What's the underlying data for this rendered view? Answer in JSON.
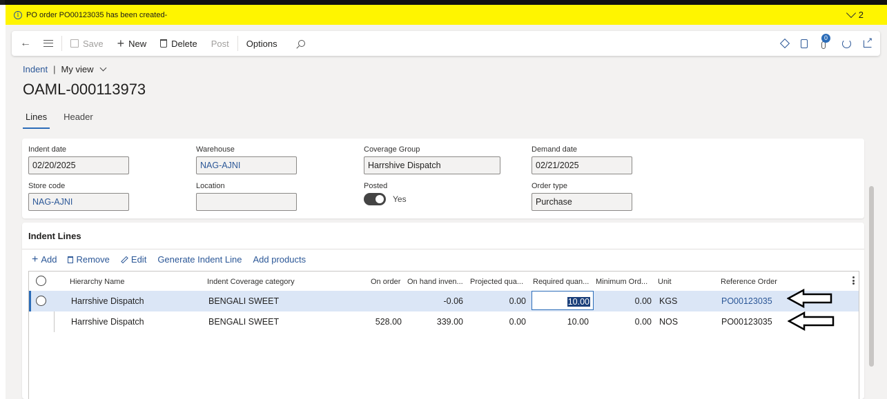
{
  "message_bar": {
    "text": "PO order PO00123035 has been created-",
    "count": "2"
  },
  "toolbar": {
    "save": "Save",
    "new": "New",
    "delete": "Delete",
    "post": "Post",
    "options": "Options",
    "notification_count": "0"
  },
  "breadcrumb": {
    "module": "Indent",
    "view": "My view"
  },
  "page_title": "OAML-000113973",
  "tabs": [
    "Lines",
    "Header"
  ],
  "fields": {
    "indent_date": {
      "label": "Indent date",
      "value": "02/20/2025"
    },
    "warehouse": {
      "label": "Warehouse",
      "value": "NAG-AJNI"
    },
    "coverage_group": {
      "label": "Coverage Group",
      "value": "Harrshive Dispatch"
    },
    "demand_date": {
      "label": "Demand date",
      "value": "02/21/2025"
    },
    "store_code": {
      "label": "Store code",
      "value": "NAG-AJNI"
    },
    "location": {
      "label": "Location",
      "value": ""
    },
    "posted": {
      "label": "Posted",
      "value": "Yes"
    },
    "order_type": {
      "label": "Order type",
      "value": "Purchase"
    }
  },
  "indent_lines": {
    "title": "Indent Lines",
    "actions": {
      "add": "Add",
      "remove": "Remove",
      "edit": "Edit",
      "generate": "Generate Indent Line",
      "add_products": "Add products"
    },
    "columns": [
      "Hierarchy Name",
      "Indent Coverage category",
      "On order",
      "On hand inven...",
      "Projected qua...",
      "Required quan...",
      "Minimum Ord...",
      "Unit",
      "Reference Order"
    ],
    "rows": [
      {
        "hierarchy": "Harrshive Dispatch",
        "category": "BENGALI SWEET",
        "on_order": "",
        "on_hand": "-0.06",
        "projected": "0.00",
        "required": "10.00",
        "minimum": "0.00",
        "unit": "KGS",
        "reference": "PO00123035"
      },
      {
        "hierarchy": "Harrshive Dispatch",
        "category": "BENGALI SWEET",
        "on_order": "528.00",
        "on_hand": "339.00",
        "projected": "0.00",
        "required": "10.00",
        "minimum": "0.00",
        "unit": "NOS",
        "reference": "PO00123035"
      }
    ]
  },
  "colors": {
    "message_bar_bg": "#fff500",
    "link": "#2b5797",
    "selected_row": "#dbe6f6"
  }
}
